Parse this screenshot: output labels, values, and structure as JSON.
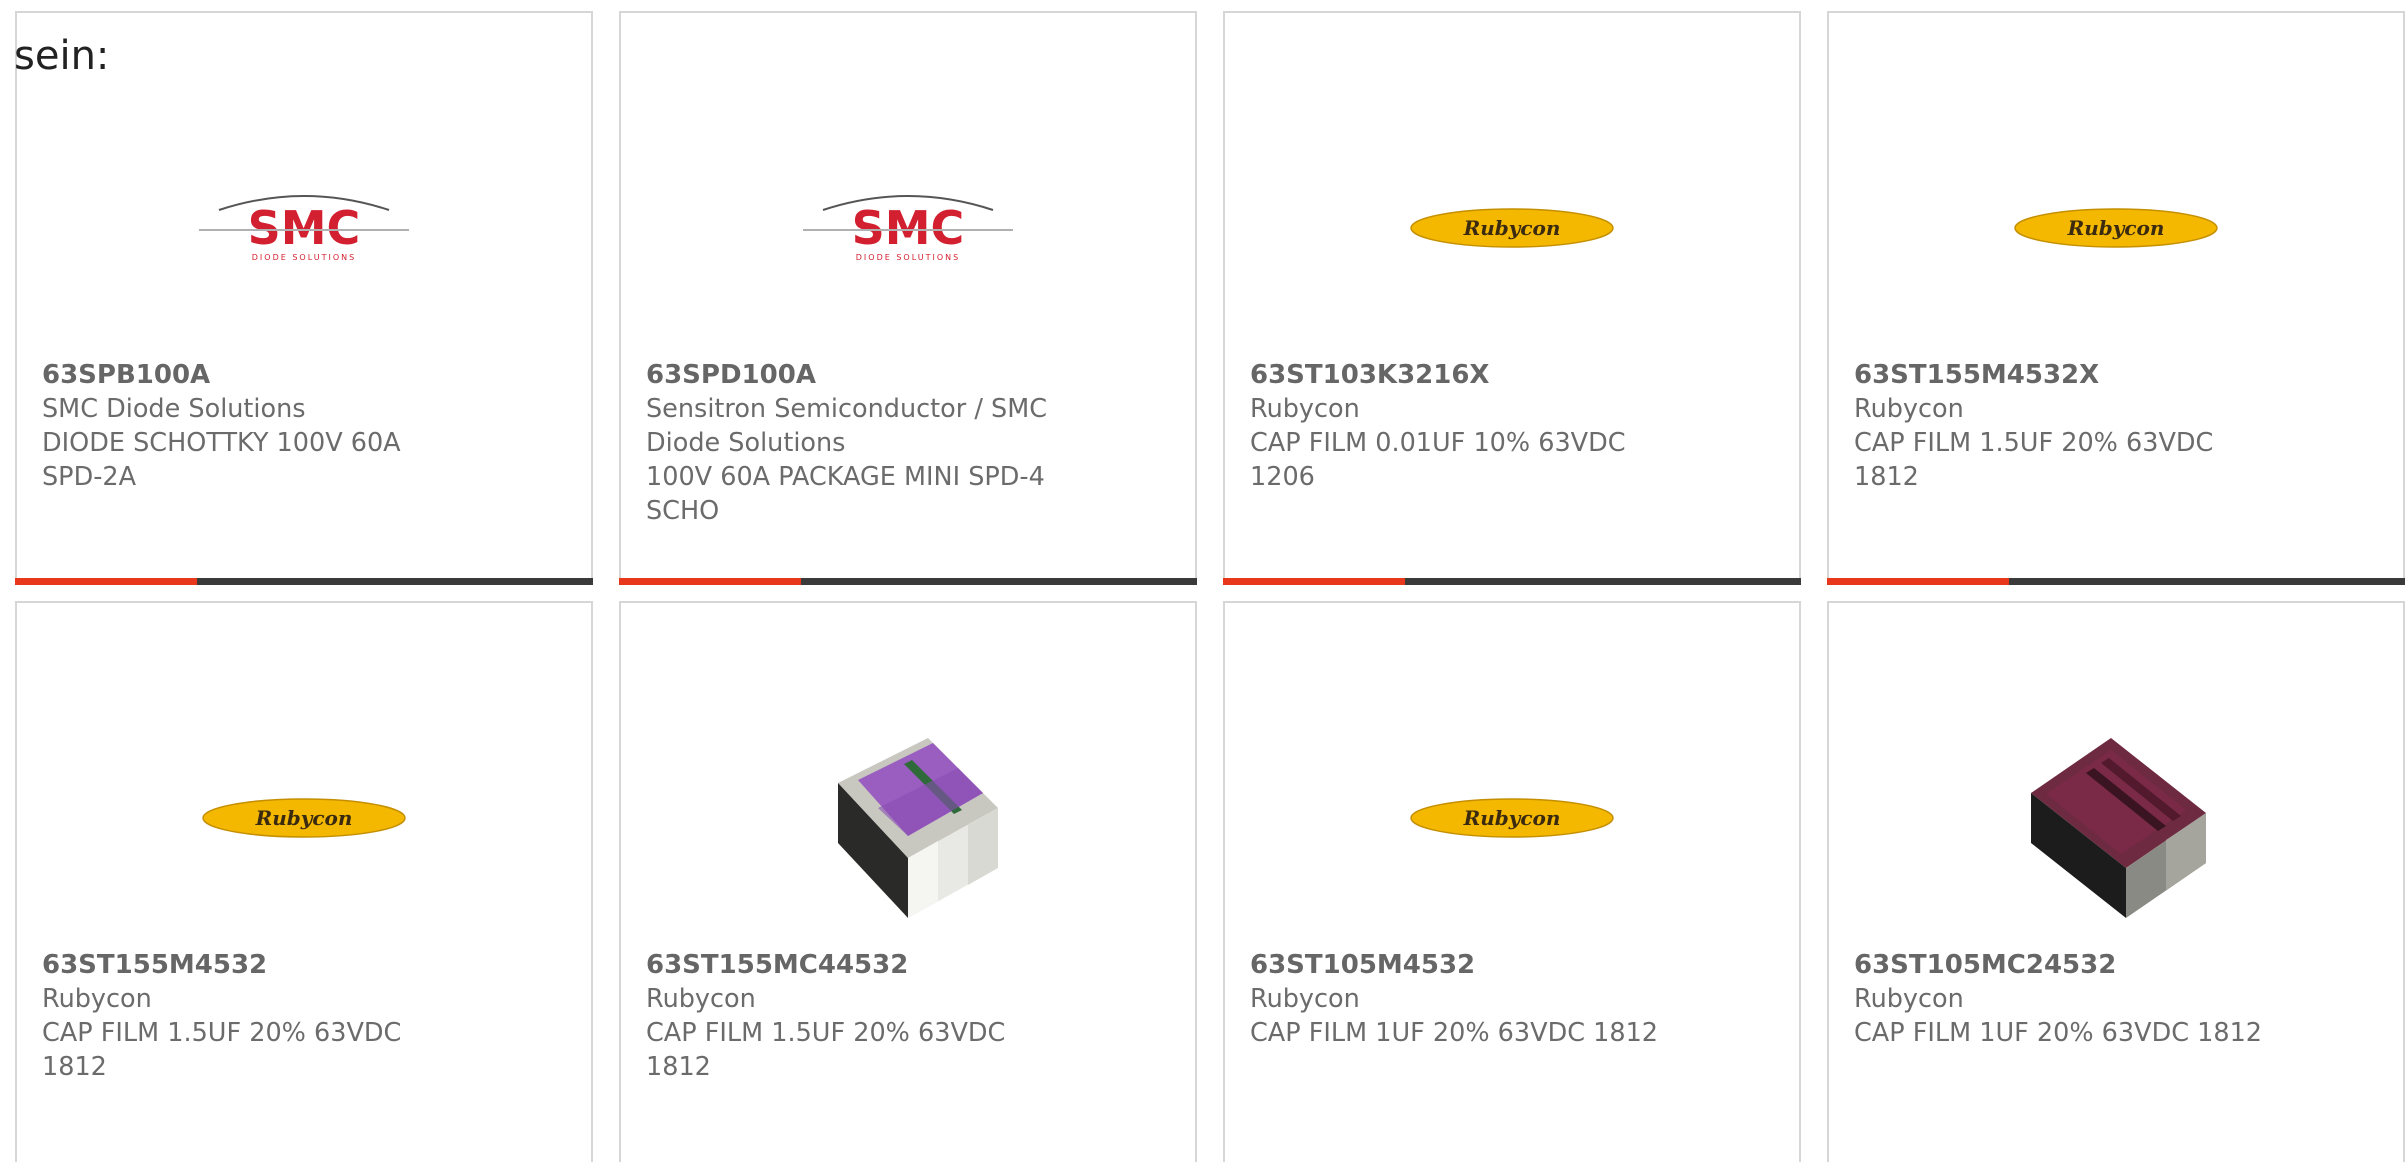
{
  "intro": {
    "text": "sein:"
  },
  "colors": {
    "accent": "#e8371b",
    "bar": "#3a3a3a",
    "border": "#d6d6d6",
    "text": "#6b6b6b"
  },
  "products": [
    {
      "part_number": "63SPB100A",
      "manufacturer": "SMC Diode Solutions",
      "description": "DIODE SCHOTTKY 100V 60A SPD-2A",
      "image": "smc-logo",
      "logo_text": "SMC",
      "logo_subtext": "DIODE SOLUTIONS"
    },
    {
      "part_number": "63SPD100A",
      "manufacturer": "Sensitron Semiconductor / SMC Diode Solutions",
      "description": "100V 60A PACKAGE MINI SPD-4 SCHO",
      "image": "smc-logo",
      "logo_text": "SMC",
      "logo_subtext": "DIODE SOLUTIONS"
    },
    {
      "part_number": "63ST103K3216X",
      "manufacturer": "Rubycon",
      "description": "CAP FILM 0.01UF 10% 63VDC 1206",
      "image": "rubycon-logo",
      "logo_text": "Rubycon"
    },
    {
      "part_number": "63ST155M4532X",
      "manufacturer": "Rubycon",
      "description": "CAP FILM 1.5UF 20% 63VDC 1812",
      "image": "rubycon-logo",
      "logo_text": "Rubycon"
    },
    {
      "part_number": "63ST155M4532",
      "manufacturer": "Rubycon",
      "description": "CAP FILM 1.5UF 20% 63VDC 1812",
      "image": "rubycon-logo",
      "logo_text": "Rubycon"
    },
    {
      "part_number": "63ST155MC44532",
      "manufacturer": "Rubycon",
      "description": "CAP FILM 1.5UF 20% 63VDC 1812",
      "image": "purple-chip-photo"
    },
    {
      "part_number": "63ST105M4532",
      "manufacturer": "Rubycon",
      "description": "CAP FILM 1UF 20% 63VDC 1812",
      "image": "rubycon-logo",
      "logo_text": "Rubycon"
    },
    {
      "part_number": "63ST105MC24532",
      "manufacturer": "Rubycon",
      "description": "CAP FILM 1UF 20% 63VDC 1812",
      "image": "magenta-chip-photo"
    }
  ]
}
